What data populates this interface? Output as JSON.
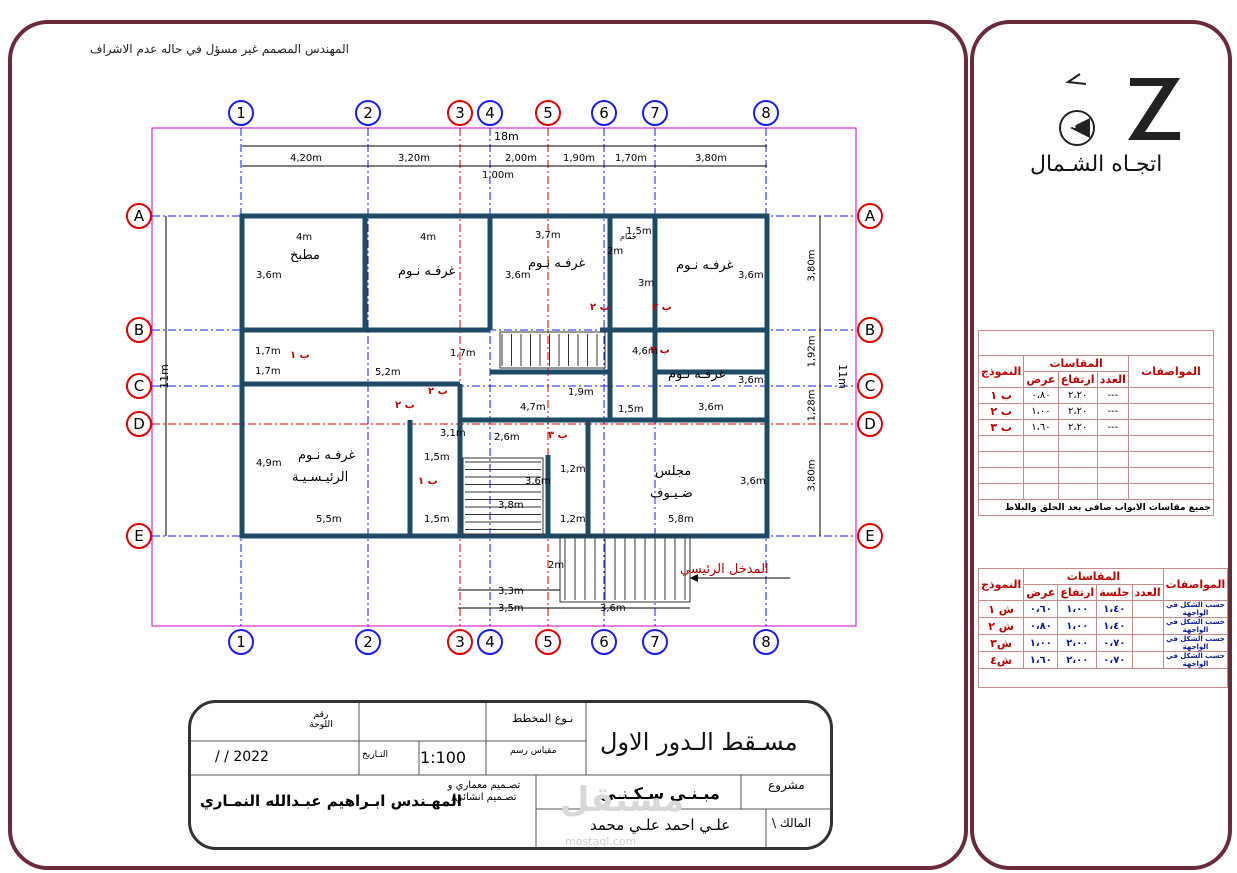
{
  "note": "المهندس المصمم غير مسؤل في حاله عدم الاشراف",
  "north": {
    "label": "اتجـاه الشـمال",
    "letter": "N"
  },
  "grid": {
    "numbers": [
      "1",
      "2",
      "3",
      "4",
      "5",
      "6",
      "7",
      "8"
    ],
    "letters": [
      "A",
      "B",
      "C",
      "D",
      "E"
    ]
  },
  "dims": {
    "total_width": "18m",
    "top_segments": [
      "4,20m",
      "3,20m",
      "2,00m",
      "1,90m",
      "1,70m",
      "3,80m"
    ],
    "small": "1,00m",
    "right": [
      "3,80m",
      "1,92m",
      "1,28m",
      "3,80m"
    ],
    "right_total": "11m",
    "left_total": "11m",
    "bottom": [
      "3,3m",
      "3,5m",
      "3,6m"
    ]
  },
  "rooms": {
    "kitchen": "مطبخ",
    "bed1": "غرفـه نـوم",
    "bed2": "غرفـه نـوم",
    "bed3": "غرفـه نـوم",
    "bed4": "غرفـه نـوم",
    "master1": "غرفـه نـوم",
    "master2": "الرئيـسـيـة",
    "majlis1": "مجلس",
    "majlis2": "ضـيـوف",
    "entrance": "المدخل الرئيسي",
    "bath": "حمام"
  },
  "room_dims": [
    "4m",
    "4m",
    "3,7m",
    "3,6m",
    "3,6m",
    "3,6m",
    "3,6m",
    "1,5m",
    "2m",
    "5,2m",
    "1,7m",
    "1,7m",
    "1,7m",
    "4,7m",
    "1,9m",
    "1,5m",
    "3,6m",
    "3m",
    "2,6m",
    "4,6m",
    "4,9m",
    "1,5m",
    "3,1m",
    "3,6m",
    "3,6m",
    "1,2m",
    "1,2m",
    "5,5m",
    "1,5m",
    "5,8m",
    "3,8m",
    "2m"
  ],
  "door_tags": [
    "ب ١",
    "ب ٢",
    "ب ٢",
    "ب ٢",
    "ب ٢",
    "ب ١",
    "ب ٢",
    "ب ٣"
  ],
  "doors_table": {
    "col_model": "النموذج",
    "col_dims": "المقاسات",
    "col_width": "عرض",
    "col_height": "ارتفاع",
    "col_count": "العدد",
    "col_specs": "المواصفات",
    "rows": [
      {
        "model": "ب ١",
        "width": "٠،٨٠",
        "height": "٢،٢٠",
        "count": "---"
      },
      {
        "model": "ب ٢",
        "width": "١،٠٠",
        "height": "٢،٢٠",
        "count": "---"
      },
      {
        "model": "ب ٣",
        "width": "١،٦٠",
        "height": "٢،٢٠",
        "count": "---"
      }
    ],
    "footer": "جميع مقاسات الابواب صافى بعد الحلق والبلاط"
  },
  "windows_table": {
    "col_model": "النموذج",
    "col_dims": "المقاسات",
    "col_width": "عرض",
    "col_height": "ارتفاع",
    "col_sill": "جلسة",
    "col_count": "العدد",
    "col_specs": "المواصفات",
    "rows": [
      {
        "model": "ش ١",
        "width": "٠،٦٠",
        "height": "١،٠٠",
        "sill": "١،٤٠",
        "spec": "حسب الشكل في الواجهة"
      },
      {
        "model": "ش ٢",
        "width": "٠،٨٠",
        "height": "١،٠٠",
        "sill": "١،٤٠",
        "spec": "حسب الشكل في الواجهة"
      },
      {
        "model": "ش٣",
        "width": "١،٠٠",
        "height": "٢،٠٠",
        "sill": "٠،٧٠",
        "spec": "حسب الشكل في الواجهة"
      },
      {
        "model": "ش٤",
        "width": "١،٦٠",
        "height": "٢،٠٠",
        "sill": "٠،٧٠",
        "spec": "حسب الشكل في الواجهة"
      }
    ]
  },
  "title_block": {
    "sheet_no": "رقم اللوحة",
    "plan_type_label": "نـوع المخطط",
    "plan_title": "مسـقط الـدور الاول",
    "scale_label": "مقياس رسم",
    "scale": "1:100",
    "date_label": "التـاريخ",
    "date": "/ / 2022",
    "project_label": "مشروع",
    "project": "مبـنـى سـكـنـي",
    "design_label": "تصـميم معماري و تصـميم انشائي/",
    "engineer": "المهـندس ابـراهيم عبـدالله النمـاري",
    "owner_label": "المالك \\",
    "owner": "علـي احمد علـي محمد",
    "watermark": "مستقل",
    "watermark_url": "mostaql.com"
  },
  "colors": {
    "frame": "#6b2a3a",
    "wall": "#2a5b78",
    "axis_blue": "#1a1aff",
    "axis_red": "#e00000",
    "magenta": "#d000d0",
    "dim": "#000000",
    "green": "#00a000"
  }
}
